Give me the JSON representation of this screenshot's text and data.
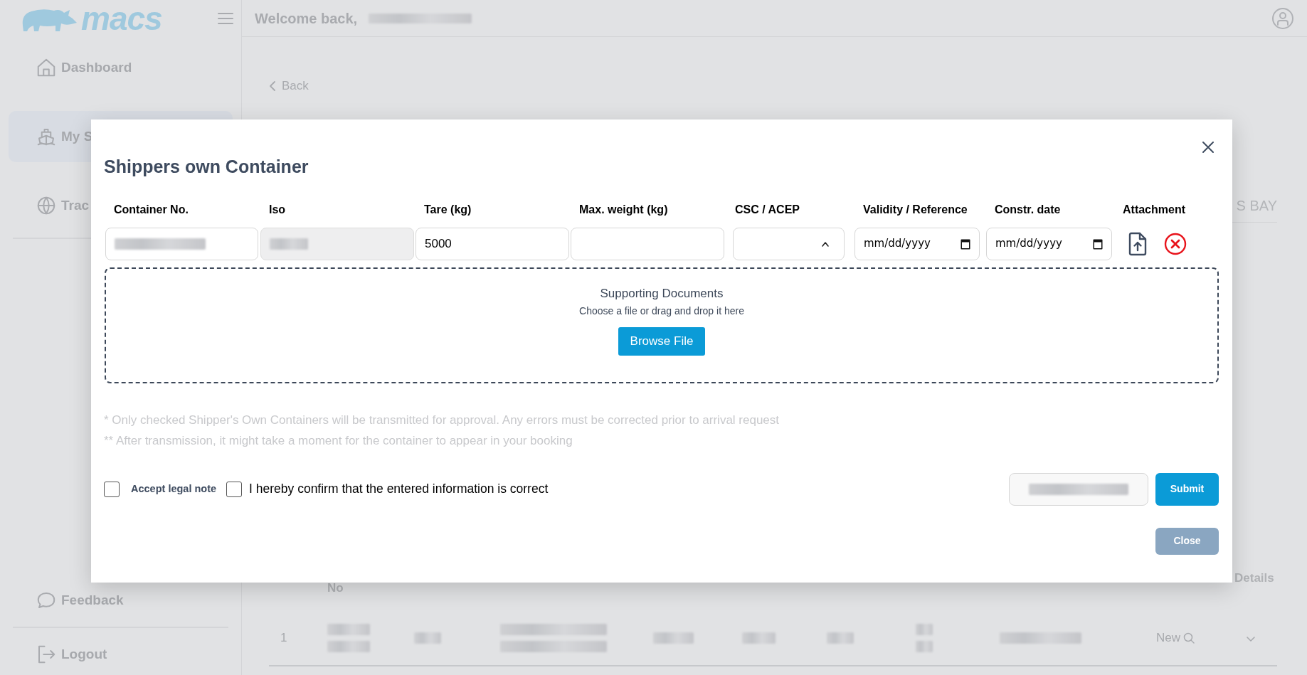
{
  "app": {
    "brand": "macs",
    "header": {
      "greeting": "Welcome back,"
    },
    "sidebar": {
      "items": [
        {
          "label": "Dashboard",
          "selected": false
        },
        {
          "label": "My S",
          "selected": true
        },
        {
          "label": "Trac",
          "selected": false
        }
      ],
      "footer_items": [
        {
          "label": "Feedback"
        },
        {
          "label": "Logout"
        }
      ]
    },
    "page": {
      "back": "Back",
      "column_header": "S BAY",
      "table": {
        "columns": [
          {
            "label": "No"
          },
          {
            "label": "Details"
          }
        ],
        "rows": [
          {
            "index": "1",
            "status": "New"
          }
        ]
      }
    }
  },
  "modal": {
    "title": "Shippers own Container",
    "columns": [
      "Container No.",
      "Iso",
      "Tare (kg)",
      "Max. weight (kg)",
      "CSC / ACEP",
      "Validity / Reference",
      "Constr. date",
      "Attachment"
    ],
    "fields": [
      {
        "kind": "text",
        "redacted": true,
        "disabled": false
      },
      {
        "kind": "text",
        "redacted": true,
        "disabled": true
      },
      {
        "kind": "text",
        "value": "5000",
        "disabled": false
      },
      {
        "kind": "text",
        "disabled": false
      },
      {
        "kind": "select",
        "expanded": true
      },
      {
        "kind": "date",
        "placeholder": "mm/dd/yyyy"
      },
      {
        "kind": "date",
        "placeholder": "mm/dd/yyyy"
      }
    ],
    "dropzone": {
      "title": "Supporting Documents",
      "hint": "Choose a file or drag and drop it here",
      "button": "Browse File"
    },
    "notes": [
      "* Only checked Shipper's Own Containers will be transmitted for approval. Any errors must be corrected prior to arrival request",
      "** After transmission, it might take a moment for the container to appear in your booking"
    ],
    "checkboxes": [
      {
        "label": "Accept legal note",
        "checked": false
      },
      {
        "label": "I hereby confirm that the entered information is correct",
        "checked": false
      }
    ],
    "actions": [
      {
        "kind": "redacted"
      },
      {
        "kind": "primary",
        "label": "Submit",
        "disabled": false
      }
    ],
    "close_button": {
      "label": "Close",
      "disabled": true
    }
  }
}
